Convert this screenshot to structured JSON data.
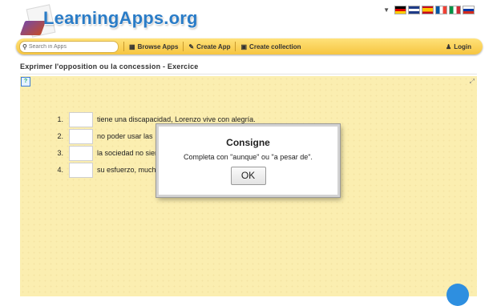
{
  "header": {
    "logo_text": "LearningApps.org",
    "languages": [
      "de",
      "gb",
      "es",
      "fr",
      "it",
      "ru"
    ],
    "lang_toggle_icon": "triangle-down"
  },
  "navbar": {
    "search_placeholder": "Search in Apps",
    "search_icon": "magnifier",
    "browse_label": "Browse Apps",
    "create_app_label": "Create App",
    "create_collection_label": "Create collection",
    "login_label": "Login",
    "accent_color": "#f6c540"
  },
  "page": {
    "title": "Exprimer l'opposition ou la concession - Exercice"
  },
  "exercise": {
    "rows": [
      {
        "number": "1.",
        "text": "tiene una discapacidad, Lorenzo vive con alegría."
      },
      {
        "number": "2.",
        "text": "no poder usar las"
      },
      {
        "number": "3.",
        "text": "la sociedad no sier"
      },
      {
        "number": "4.",
        "text": "su esfuerzo, much"
      }
    ]
  },
  "modal": {
    "title": "Consigne",
    "text": "Completa con \"aunque\" ou \"a pesar de\".",
    "ok_label": "OK"
  }
}
